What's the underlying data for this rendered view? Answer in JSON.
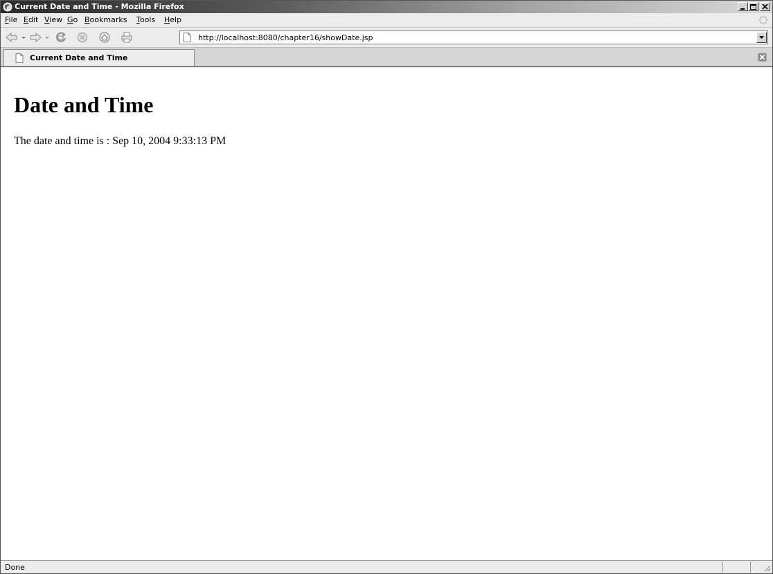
{
  "window": {
    "title": "Current Date and Time - Mozilla Firefox"
  },
  "menu": {
    "file": {
      "accel": "F",
      "rest": "ile"
    },
    "edit": {
      "accel": "E",
      "rest": "dit"
    },
    "view": {
      "accel": "V",
      "rest": "iew"
    },
    "go": {
      "accel": "G",
      "rest": "o"
    },
    "bookmarks": {
      "accel": "B",
      "rest": "ookmarks"
    },
    "tools": {
      "accel": "T",
      "rest": "ools"
    },
    "help": {
      "accel": "H",
      "rest": "elp"
    }
  },
  "navigation": {
    "url": "http://localhost:8080/chapter16/showDate.jsp",
    "icons": [
      "back-icon",
      "back-dropdown-icon",
      "forward-icon",
      "forward-dropdown-icon",
      "reload-icon",
      "stop-icon",
      "home-icon",
      "print-icon"
    ]
  },
  "tabs": [
    {
      "label": "Current Date and Time"
    }
  ],
  "page": {
    "heading": "Date and Time",
    "body_text": "The date and time is : Sep 10, 2004 9:33:13 PM"
  },
  "status": {
    "text": "Done"
  },
  "colors": {
    "titlebar_start": "#2a2a2a",
    "titlebar_end": "#d8d8d8",
    "chrome": "#ececec",
    "content_bg": "#ffffff"
  }
}
